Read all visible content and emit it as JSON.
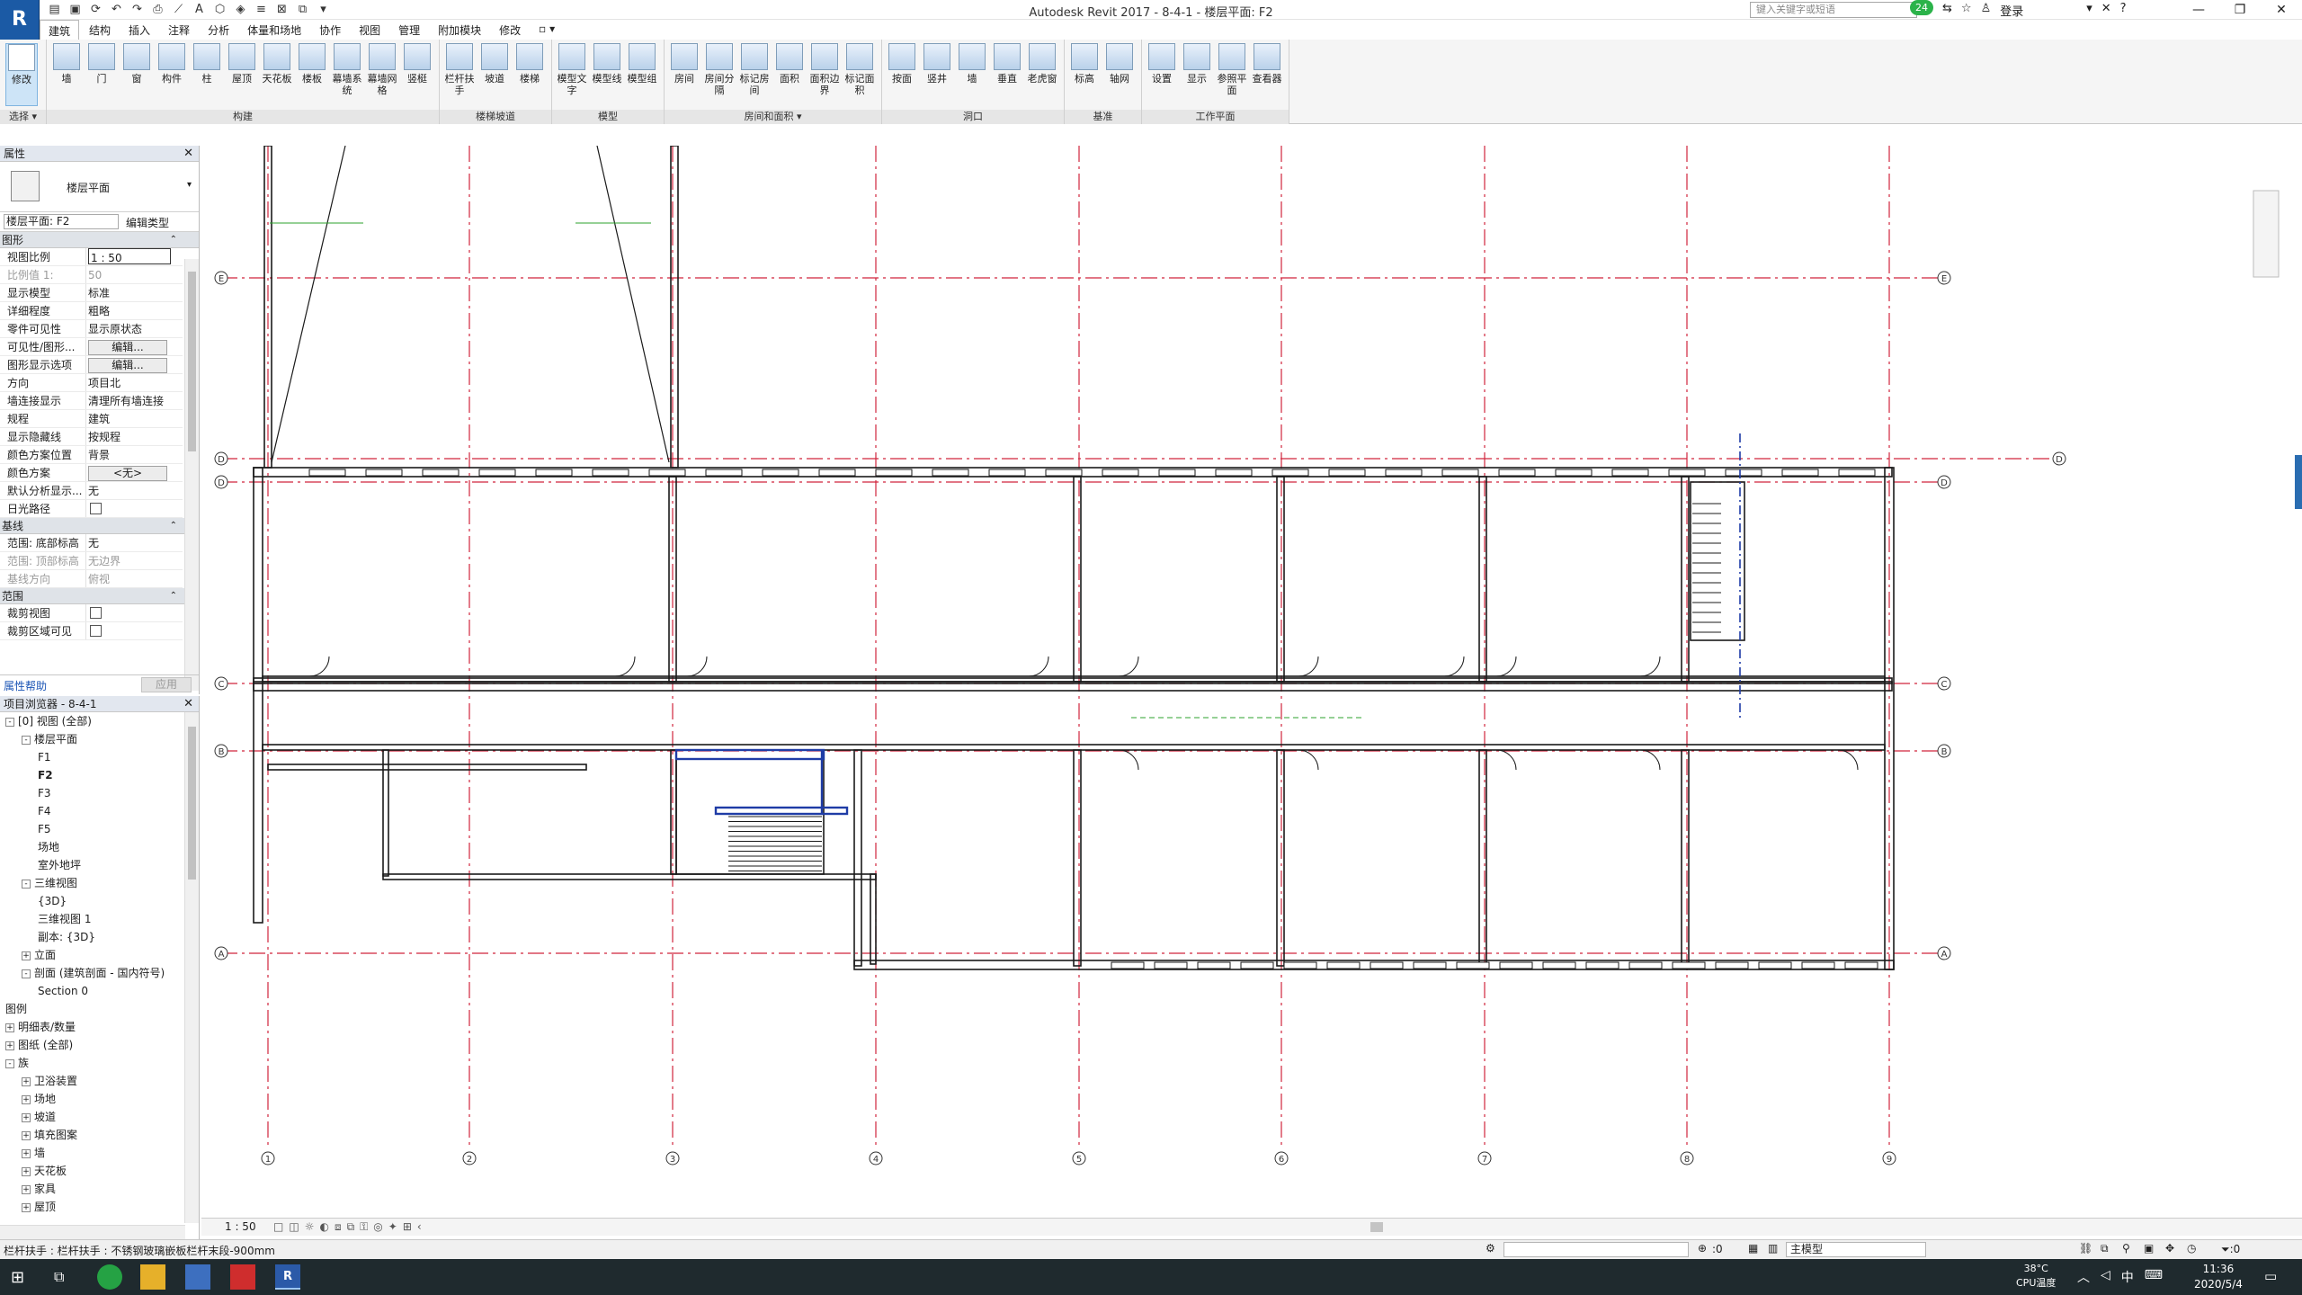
{
  "app": {
    "logo_letter": "R",
    "title": "Autodesk Revit 2017 -     8-4-1 - 楼层平面: F2",
    "search_placeholder": "键入关键字或短语",
    "notification_count": "24",
    "login_label": "登录",
    "qat_icons": [
      "open-icon",
      "save-icon",
      "sync-icon",
      "undo-icon",
      "redo-icon",
      "print-icon",
      "measure-icon",
      "text-icon",
      "3d-icon",
      "section-icon",
      "thin-lines-icon",
      "close-hidden-icon",
      "switch-windows-icon",
      "customize-icon"
    ]
  },
  "tabs": [
    {
      "label": "建筑",
      "active": true
    },
    {
      "label": "结构"
    },
    {
      "label": "插入"
    },
    {
      "label": "注释"
    },
    {
      "label": "分析"
    },
    {
      "label": "体量和场地"
    },
    {
      "label": "协作"
    },
    {
      "label": "视图"
    },
    {
      "label": "管理"
    },
    {
      "label": "附加模块"
    },
    {
      "label": "修改"
    },
    {
      "label": "▫ ▾"
    }
  ],
  "ribbon": {
    "select_label": "选择 ▾",
    "panels": [
      {
        "title": "构建",
        "buttons": [
          "墙",
          "门",
          "窗",
          "构件",
          "柱",
          "屋顶",
          "天花板",
          "楼板",
          "幕墙系统",
          "幕墙网格",
          "竖梃"
        ]
      },
      {
        "title": "楼梯坡道",
        "buttons": [
          "栏杆扶手",
          "坡道",
          "楼梯"
        ]
      },
      {
        "title": "模型",
        "buttons": [
          "模型文字",
          "模型线",
          "模型组"
        ]
      },
      {
        "title": "房间和面积 ▾",
        "buttons": [
          "房间",
          "房间分隔",
          "标记房间",
          "面积",
          "面积边界",
          "标记面积"
        ]
      },
      {
        "title": "洞口",
        "buttons": [
          "按面",
          "竖井",
          "墙",
          "垂直",
          "老虎窗"
        ]
      },
      {
        "title": "基准",
        "buttons": [
          "标高",
          "轴网"
        ]
      },
      {
        "title": "工作平面",
        "buttons": [
          "设置",
          "显示",
          "参照平面",
          "查看器"
        ]
      }
    ],
    "modify_label": "修改"
  },
  "properties": {
    "header": "属性",
    "type_name": "楼层平面",
    "instance_selector": "楼层平面: F2",
    "edit_type_label": "编辑类型",
    "groups": [
      {
        "name": "图形",
        "rows": [
          {
            "k": "视图比例",
            "v": "1 : 50",
            "kind": "input"
          },
          {
            "k": "比例值 1:",
            "v": "50",
            "dis": true
          },
          {
            "k": "显示模型",
            "v": "标准"
          },
          {
            "k": "详细程度",
            "v": "粗略"
          },
          {
            "k": "零件可见性",
            "v": "显示原状态"
          },
          {
            "k": "可见性/图形...",
            "v": "编辑...",
            "kind": "button"
          },
          {
            "k": "图形显示选项",
            "v": "编辑...",
            "kind": "button"
          },
          {
            "k": "方向",
            "v": "项目北"
          },
          {
            "k": "墙连接显示",
            "v": "清理所有墙连接"
          },
          {
            "k": "规程",
            "v": "建筑"
          },
          {
            "k": "显示隐藏线",
            "v": "按规程"
          },
          {
            "k": "颜色方案位置",
            "v": "背景"
          },
          {
            "k": "颜色方案",
            "v": "<无>",
            "kind": "button"
          },
          {
            "k": "默认分析显示...",
            "v": "无"
          },
          {
            "k": "日光路径",
            "v": "",
            "kind": "check"
          }
        ]
      },
      {
        "name": "基线",
        "rows": [
          {
            "k": "范围: 底部标高",
            "v": "无"
          },
          {
            "k": "范围: 顶部标高",
            "v": "无边界",
            "dis": true
          },
          {
            "k": "基线方向",
            "v": "俯视",
            "dis": true
          }
        ]
      },
      {
        "name": "范围",
        "rows": [
          {
            "k": "裁剪视图",
            "v": "",
            "kind": "check"
          },
          {
            "k": "裁剪区域可见",
            "v": "",
            "kind": "check"
          }
        ]
      }
    ],
    "help_link": "属性帮助",
    "apply_label": "应用"
  },
  "browser": {
    "header": "项目浏览器 - 8-4-1",
    "nodes": [
      {
        "label": "[0] 视图 (全部)",
        "level": 0,
        "tg": "-"
      },
      {
        "label": "楼层平面",
        "level": 1,
        "tg": "-"
      },
      {
        "label": "F1",
        "level": 2
      },
      {
        "label": "F2",
        "level": 2,
        "bold": true
      },
      {
        "label": "F3",
        "level": 2
      },
      {
        "label": "F4",
        "level": 2
      },
      {
        "label": "F5",
        "level": 2
      },
      {
        "label": "场地",
        "level": 2
      },
      {
        "label": "室外地坪",
        "level": 2
      },
      {
        "label": "三维视图",
        "level": 1,
        "tg": "-"
      },
      {
        "label": "{3D}",
        "level": 2
      },
      {
        "label": "三维视图 1",
        "level": 2
      },
      {
        "label": "副本: {3D}",
        "level": 2
      },
      {
        "label": "立面",
        "level": 1,
        "tg": "+"
      },
      {
        "label": "剖面 (建筑剖面 - 国内符号)",
        "level": 1,
        "tg": "-"
      },
      {
        "label": "Section 0",
        "level": 2
      },
      {
        "label": "图例",
        "level": 0
      },
      {
        "label": "明细表/数量",
        "level": 0,
        "tg": "+"
      },
      {
        "label": "图纸 (全部)",
        "level": 0,
        "tg": "+"
      },
      {
        "label": "族",
        "level": 0,
        "tg": "-"
      },
      {
        "label": "卫浴装置",
        "level": 1,
        "tg": "+"
      },
      {
        "label": "场地",
        "level": 1,
        "tg": "+"
      },
      {
        "label": "坡道",
        "level": 1,
        "tg": "+"
      },
      {
        "label": "填充图案",
        "level": 1,
        "tg": "+"
      },
      {
        "label": "墙",
        "level": 1,
        "tg": "+"
      },
      {
        "label": "天花板",
        "level": 1,
        "tg": "+"
      },
      {
        "label": "家具",
        "level": 1,
        "tg": "+"
      },
      {
        "label": "屋顶",
        "level": 1,
        "tg": "+"
      }
    ]
  },
  "drawing": {
    "grid_numbers": [
      "1",
      "2",
      "3",
      "4",
      "5",
      "6",
      "7",
      "8",
      "9"
    ],
    "grid_letters": [
      "E",
      "D",
      "C",
      "B",
      "A"
    ],
    "grid_top_letter": "D",
    "colors": {
      "grid": "#d0243c",
      "wall": "#1a1a1a",
      "selected": "#1f3ca6",
      "dim": "#2ca02c"
    }
  },
  "view_control": {
    "scale": "1 : 50"
  },
  "status": {
    "message": "栏杆扶手 : 栏杆扶手 : 不锈钢玻璃嵌板栏杆末段-900mm",
    "select_count": ":0",
    "model": "主模型"
  },
  "taskbar": {
    "temp": "38°C",
    "temp_label": "CPU温度",
    "ime": "中",
    "time": "11:36",
    "date": "2020/5/4"
  }
}
